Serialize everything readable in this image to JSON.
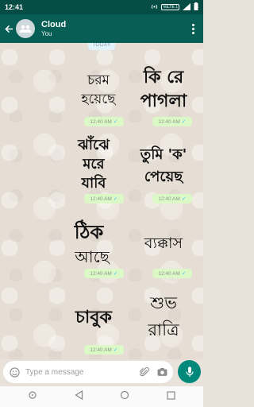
{
  "status_bar": {
    "time": "12:41",
    "volte": "VoLTE 1",
    "icons": [
      "hotspot-icon",
      "signal-icon",
      "battery-icon"
    ]
  },
  "app_bar": {
    "title": "Cloud",
    "subtitle": "You",
    "color": "#075e54"
  },
  "chat": {
    "date_chip": "TODAY",
    "stickers": [
      {
        "lines": [
          "চরম",
          "হয়েছে"
        ],
        "time": "12:40 AM"
      },
      {
        "lines": [
          "কি রে",
          "পাগলা"
        ],
        "time": "12:40 AM"
      },
      {
        "lines": [
          "ঝাঁঝে",
          "মরে",
          "যাবি"
        ],
        "time": "12:40 AM"
      },
      {
        "lines": [
          "তুমি 'ক'",
          "পেয়েছ"
        ],
        "time": "12:40 AM"
      },
      {
        "lines": [
          "ঠিক",
          "আছে"
        ],
        "time": "12:40 AM"
      },
      {
        "lines": [
          "ব্যক্কাস"
        ],
        "time": "12:40 AM"
      },
      {
        "lines": [
          "চাবুক"
        ],
        "time": "12:40 AM"
      },
      {
        "lines": [
          "শুভ",
          "রাত্রি"
        ],
        "time": ""
      }
    ],
    "tick_symbol": "✓",
    "tick_color": "#4fc3f7",
    "bubble_color": "#dcf8c6"
  },
  "composer": {
    "placeholder": "Type a message",
    "mic_color": "#00897b"
  },
  "nav": {
    "icons": [
      "recent-apps-icon",
      "back-nav-icon",
      "home-icon",
      "overview-icon"
    ]
  }
}
